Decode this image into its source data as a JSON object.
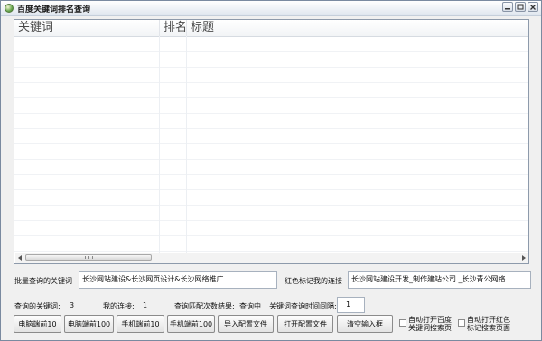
{
  "window": {
    "title": "百度关键词排名查询",
    "icon": "app-globe-icon"
  },
  "list": {
    "columns": [
      "关键词",
      "排名",
      "标题"
    ],
    "rows": []
  },
  "batch_keywords": {
    "label": "批量查询的关键词",
    "value": "长沙网站建设&长沙网页设计&长沙网络推广"
  },
  "red_mark": {
    "label": "红色标记我的连接",
    "value": "长沙网站建设开发_制作建站公司 _长沙青公网络"
  },
  "status": {
    "keyword_count_label": "查询的关键词:",
    "keyword_count_value": "3",
    "my_link_label": "我的连接:",
    "my_link_value": "1",
    "match_count_label": "查询匹配次数结果:",
    "match_count_value": "查询中",
    "interval_label": "关键词查询时间间隔:",
    "interval_value": "1"
  },
  "buttons": {
    "pc_top10": "电脑端前10",
    "pc_top100": "电脑端前100",
    "mobile_top10": "手机端前10",
    "mobile_top100": "手机端前100",
    "import_config": "导入配置文件",
    "open_config": "打开配置文件",
    "clear_input": "清空输入框"
  },
  "options": {
    "auto_open_baidu_line1": "自动打开百度",
    "auto_open_baidu_line2": "关键词搜索页",
    "auto_open_red_line1": "自动打开红色",
    "auto_open_red_line2": "标记搜索页面"
  },
  "colors": {
    "window_bg": "#f0f0f0",
    "title_bar": "#dfe6ef",
    "list_border": "#8d9aab"
  }
}
